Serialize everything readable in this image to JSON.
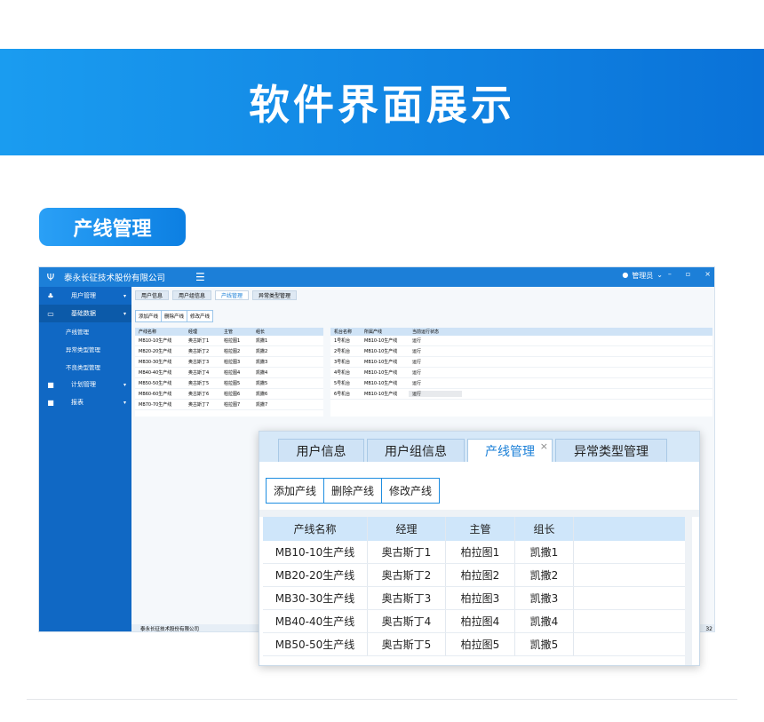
{
  "banner": {
    "title": "软件界面展示"
  },
  "section": {
    "label": "产线管理"
  },
  "app": {
    "company": "泰永长征技术股份有限公司",
    "menu_icon": "☰",
    "user": "管理员",
    "sidebar": [
      {
        "label": "用户管理",
        "icon": "users-icon"
      },
      {
        "label": "基础数据",
        "icon": "monitor-icon"
      },
      {
        "label": "产线管理",
        "sub": true
      },
      {
        "label": "异常类型管理",
        "sub": true
      },
      {
        "label": "不良类型管理",
        "sub": true
      },
      {
        "label": "计划管理",
        "icon": "briefcase-icon"
      },
      {
        "label": "报表",
        "icon": "briefcase-icon"
      }
    ],
    "tabs": [
      "用户信息",
      "用户组信息",
      "产线管理",
      "异常类型管理"
    ],
    "buttons": [
      "添加产线",
      "删除产线",
      "修改产线"
    ],
    "left_table": {
      "headers": [
        "产线名称",
        "经理",
        "主管",
        "组长"
      ],
      "rows": [
        [
          "MB10-10生产线",
          "奥古斯丁1",
          "柏拉图1",
          "凯撒1"
        ],
        [
          "MB20-20生产线",
          "奥古斯丁2",
          "柏拉图2",
          "凯撒2"
        ],
        [
          "MB30-30生产线",
          "奥古斯丁3",
          "柏拉图3",
          "凯撒3"
        ],
        [
          "MB40-40生产线",
          "奥古斯丁4",
          "柏拉图4",
          "凯撒4"
        ],
        [
          "MB50-50生产线",
          "奥古斯丁5",
          "柏拉图5",
          "凯撒5"
        ],
        [
          "MB60-60生产线",
          "奥古斯丁6",
          "柏拉图6",
          "凯撒6"
        ],
        [
          "MB70-70生产线",
          "奥古斯丁7",
          "柏拉图7",
          "凯撒7"
        ]
      ]
    },
    "right_table": {
      "headers": [
        "机台名称",
        "所属产线",
        "当前运行状态"
      ],
      "rows": [
        [
          "1号机台",
          "MB10-10生产线",
          "运行"
        ],
        [
          "2号机台",
          "MB10-10生产线",
          "运行"
        ],
        [
          "3号机台",
          "MB10-10生产线",
          "运行"
        ],
        [
          "4号机台",
          "MB10-10生产线",
          "运行"
        ],
        [
          "5号机台",
          "MB10-10生产线",
          "运行"
        ],
        [
          "6号机台",
          "MB10-10生产线",
          "运行"
        ]
      ]
    },
    "status": "泰永长征技术股份有限公司",
    "status_num": "32"
  },
  "zoom": {
    "tabs": [
      "用户信息",
      "用户组信息",
      "产线管理",
      "异常类型管理"
    ],
    "close": "×",
    "buttons": [
      "添加产线",
      "删除产线",
      "修改产线"
    ],
    "headers": [
      "产线名称",
      "经理",
      "主管",
      "组长"
    ],
    "rows": [
      [
        "MB10-10生产线",
        "奥古斯丁1",
        "柏拉图1",
        "凯撒1"
      ],
      [
        "MB20-20生产线",
        "奥古斯丁2",
        "柏拉图2",
        "凯撒2"
      ],
      [
        "MB30-30生产线",
        "奥古斯丁3",
        "柏拉图3",
        "凯撒3"
      ],
      [
        "MB40-40生产线",
        "奥古斯丁4",
        "柏拉图4",
        "凯撒4"
      ],
      [
        "MB50-50生产线",
        "奥古斯丁5",
        "柏拉图5",
        "凯撒5"
      ]
    ]
  }
}
